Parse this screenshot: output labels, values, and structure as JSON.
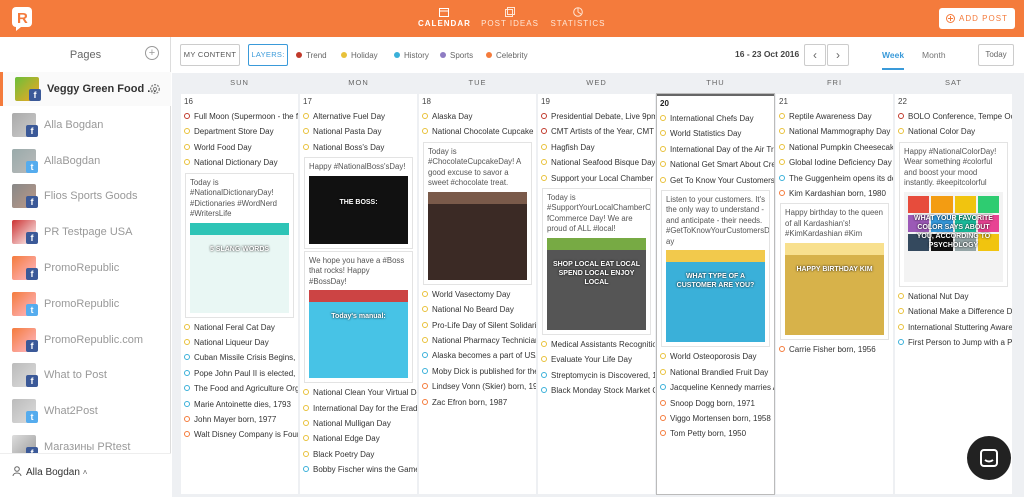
{
  "app": {
    "logo_letter": "R",
    "accent": "#f47b3c"
  },
  "nav": {
    "tabs": [
      {
        "label": "CALENDAR",
        "icon": "calendar-icon",
        "active": true
      },
      {
        "label": "POST IDEAS",
        "icon": "post-ideas-icon",
        "active": false
      },
      {
        "label": "STATISTICS",
        "icon": "statistics-icon",
        "active": false
      }
    ],
    "add_post": "ADD POST"
  },
  "sidebar": {
    "title": "Pages",
    "pages": [
      {
        "name": "Veggy Green Food ...",
        "network": "facebook",
        "active": true
      },
      {
        "name": "Alla Bogdan",
        "network": "facebook"
      },
      {
        "name": "AllaBogdan",
        "network": "twitter"
      },
      {
        "name": "Flios Sports Goods",
        "network": "facebook"
      },
      {
        "name": "PR Testpage USA",
        "network": "facebook"
      },
      {
        "name": "PromoRepublic",
        "network": "facebook"
      },
      {
        "name": "PromoRepublic",
        "network": "twitter"
      },
      {
        "name": "PromoRepublic.com",
        "network": "facebook"
      },
      {
        "name": "What to Post",
        "network": "facebook"
      },
      {
        "name": "What2Post",
        "network": "twitter"
      },
      {
        "name": "Магазины PRtest",
        "network": "facebook"
      }
    ],
    "user": "Alla Bogdan"
  },
  "toolbar": {
    "my_content": "MY CONTENT",
    "layers": "LAYERS:",
    "layer_items": [
      {
        "label": "Trend",
        "color": "#c0392b"
      },
      {
        "label": "Holiday",
        "color": "#e8c13a"
      },
      {
        "label": "History",
        "color": "#3ab0d9"
      },
      {
        "label": "Sports",
        "color": "#8e7cc3"
      },
      {
        "label": "Celebrity",
        "color": "#f47b3c"
      }
    ],
    "range": "16 - 23 Oct 2016",
    "prev": "‹",
    "next": "›",
    "view_week": "Week",
    "view_month": "Month",
    "today": "Today"
  },
  "days": [
    {
      "name": "SUN",
      "date": "16",
      "events": [
        [
          "red",
          "Full Moon (Supermoon - the f"
        ],
        [
          "yellow",
          "Department Store Day"
        ],
        [
          "yellow",
          "World Food Day"
        ],
        [
          "yellow",
          "National Dictionary Day"
        ]
      ],
      "post": {
        "text": "Today is #NationalDictionaryDay! #Dictionaries #WordNerd #WritersLife",
        "img": "5 SLANG WORDS"
      },
      "after": [
        [
          "yellow",
          "National Feral Cat Day"
        ],
        [
          "yellow",
          "National Liqueur Day"
        ],
        [
          "blue",
          "Cuban Missile Crisis Begins, 1"
        ],
        [
          "blue",
          "Pope John Paul II is elected, 1"
        ],
        [
          "blue",
          "The Food and Agriculture Org"
        ],
        [
          "blue",
          "Marie Antoinette dies, 1793"
        ],
        [
          "orange",
          "John Mayer born, 1977"
        ],
        [
          "orange",
          "Walt Disney Company is Foun"
        ]
      ]
    },
    {
      "name": "MON",
      "date": "17",
      "events": [
        [
          "yellow",
          "Alternative Fuel Day"
        ],
        [
          "yellow",
          "National Pasta Day"
        ],
        [
          "yellow",
          "National Boss's Day"
        ]
      ],
      "post": {
        "text": "Happy #NationalBoss'sDay!",
        "img": "THE BOSS:"
      },
      "post2": {
        "text": "We hope you have a #Boss that rocks! Happy #BossDay!",
        "img": "Today's manual:"
      },
      "after": [
        [
          "yellow",
          "National Clean Your Virtual De"
        ],
        [
          "yellow",
          "International Day for the Eradi"
        ],
        [
          "yellow",
          "National Mulligan Day"
        ],
        [
          "yellow",
          "National Edge Day"
        ],
        [
          "yellow",
          "Black Poetry Day"
        ],
        [
          "blue",
          "Bobby Fischer wins the Game"
        ]
      ]
    },
    {
      "name": "TUE",
      "date": "18",
      "events": [
        [
          "yellow",
          "Alaska Day"
        ],
        [
          "yellow",
          "National Chocolate Cupcake D"
        ]
      ],
      "post": {
        "text": "Today is #ChocolateCupcakeDay! A good excuse to savor a sweet #chocolate treat.",
        "img": ""
      },
      "after": [
        [
          "yellow",
          "World Vasectomy Day"
        ],
        [
          "yellow",
          "National No Beard Day"
        ],
        [
          "yellow",
          "Pro-Life Day of Silent Solidarit"
        ],
        [
          "yellow",
          "National Pharmacy Technician"
        ],
        [
          "blue",
          "Alaska becomes a part of USA,"
        ],
        [
          "blue",
          "Moby Dick is published for the"
        ],
        [
          "orange",
          "Lindsey Vonn (Skier) born, 198"
        ],
        [
          "orange",
          "Zac Efron born, 1987"
        ]
      ]
    },
    {
      "name": "WED",
      "date": "19",
      "events": [
        [
          "red",
          "Presidential Debate, Live 9pm"
        ],
        [
          "red",
          "CMT Artists of the Year, CMT"
        ],
        [
          "yellow",
          "Hagfish Day"
        ],
        [
          "yellow",
          "National Seafood Bisque Day"
        ],
        [
          "yellow",
          "Support your Local Chamber o"
        ]
      ],
      "post": {
        "text": "Today is #SupportYourLocalChamberO fCommerce Day! We are proud of ALL #local!",
        "img": "SHOP LOCAL EAT LOCAL SPEND LOCAL ENJOY LOCAL"
      },
      "after": [
        [
          "yellow",
          "Medical Assistants Recognition"
        ],
        [
          "yellow",
          "Evaluate Your Life Day"
        ],
        [
          "blue",
          "Streptomycin is Discovered, 1"
        ],
        [
          "blue",
          "Black Monday Stock Market Cr"
        ]
      ]
    },
    {
      "name": "THU",
      "date": "20",
      "today": true,
      "events": [
        [
          "yellow",
          "International Chefs Day"
        ],
        [
          "yellow",
          "World Statistics Day"
        ],
        [
          "yellow",
          "International Day of the Air Tr"
        ],
        [
          "yellow",
          "National Get Smart About Cre"
        ],
        [
          "yellow",
          "Get To Know Your Customers"
        ]
      ],
      "post": {
        "text": "Listen to your customers. It's the only way to understand - and anticipate - their needs. #GetToKnowYourCustomersD ay",
        "img": "WHAT TYPE OF A CUSTOMER ARE YOU?"
      },
      "after": [
        [
          "yellow",
          "World Osteoporosis Day"
        ],
        [
          "yellow",
          "National Brandied Fruit Day"
        ],
        [
          "blue",
          "Jacqueline Kennedy marries Ar"
        ],
        [
          "orange",
          "Snoop Dogg born, 1971"
        ],
        [
          "orange",
          "Viggo Mortensen born, 1958"
        ],
        [
          "orange",
          "Tom Petty born, 1950"
        ]
      ]
    },
    {
      "name": "FRI",
      "date": "21",
      "events": [
        [
          "yellow",
          "Reptile Awareness Day"
        ],
        [
          "yellow",
          "National Mammography Day"
        ],
        [
          "yellow",
          "National Pumpkin Cheesecake"
        ],
        [
          "yellow",
          "Global Iodine Deficiency Day"
        ],
        [
          "blue",
          "The Guggenheim opens its do"
        ],
        [
          "orange",
          "Kim Kardashian born, 1980"
        ]
      ],
      "post": {
        "text": "Happy birthday to the queen of all Kardashian's! #KimKardashian #Kim",
        "img": "HAPPY BIRTHDAY KIM"
      },
      "after": [
        [
          "orange",
          "Carrie Fisher born, 1956"
        ]
      ]
    },
    {
      "name": "SAT",
      "date": "22",
      "events": [
        [
          "red",
          "BOLO Conference, Tempe Oct"
        ],
        [
          "yellow",
          "National Color Day"
        ]
      ],
      "post": {
        "text": "Happy #NationalColorDay! Wear something #colorful and boost your mood instantly. #keepitcolorful",
        "img": "WHAT YOUR FAVORITE COLOR SAYS ABOUT YOU, ACCORDING TO PSYCHOLOGY"
      },
      "after": [
        [
          "yellow",
          "National Nut Day"
        ],
        [
          "yellow",
          "National Make a Difference Da"
        ],
        [
          "yellow",
          "International Stuttering Aware"
        ],
        [
          "blue",
          "First Person to Jump with a Pa"
        ]
      ]
    }
  ]
}
